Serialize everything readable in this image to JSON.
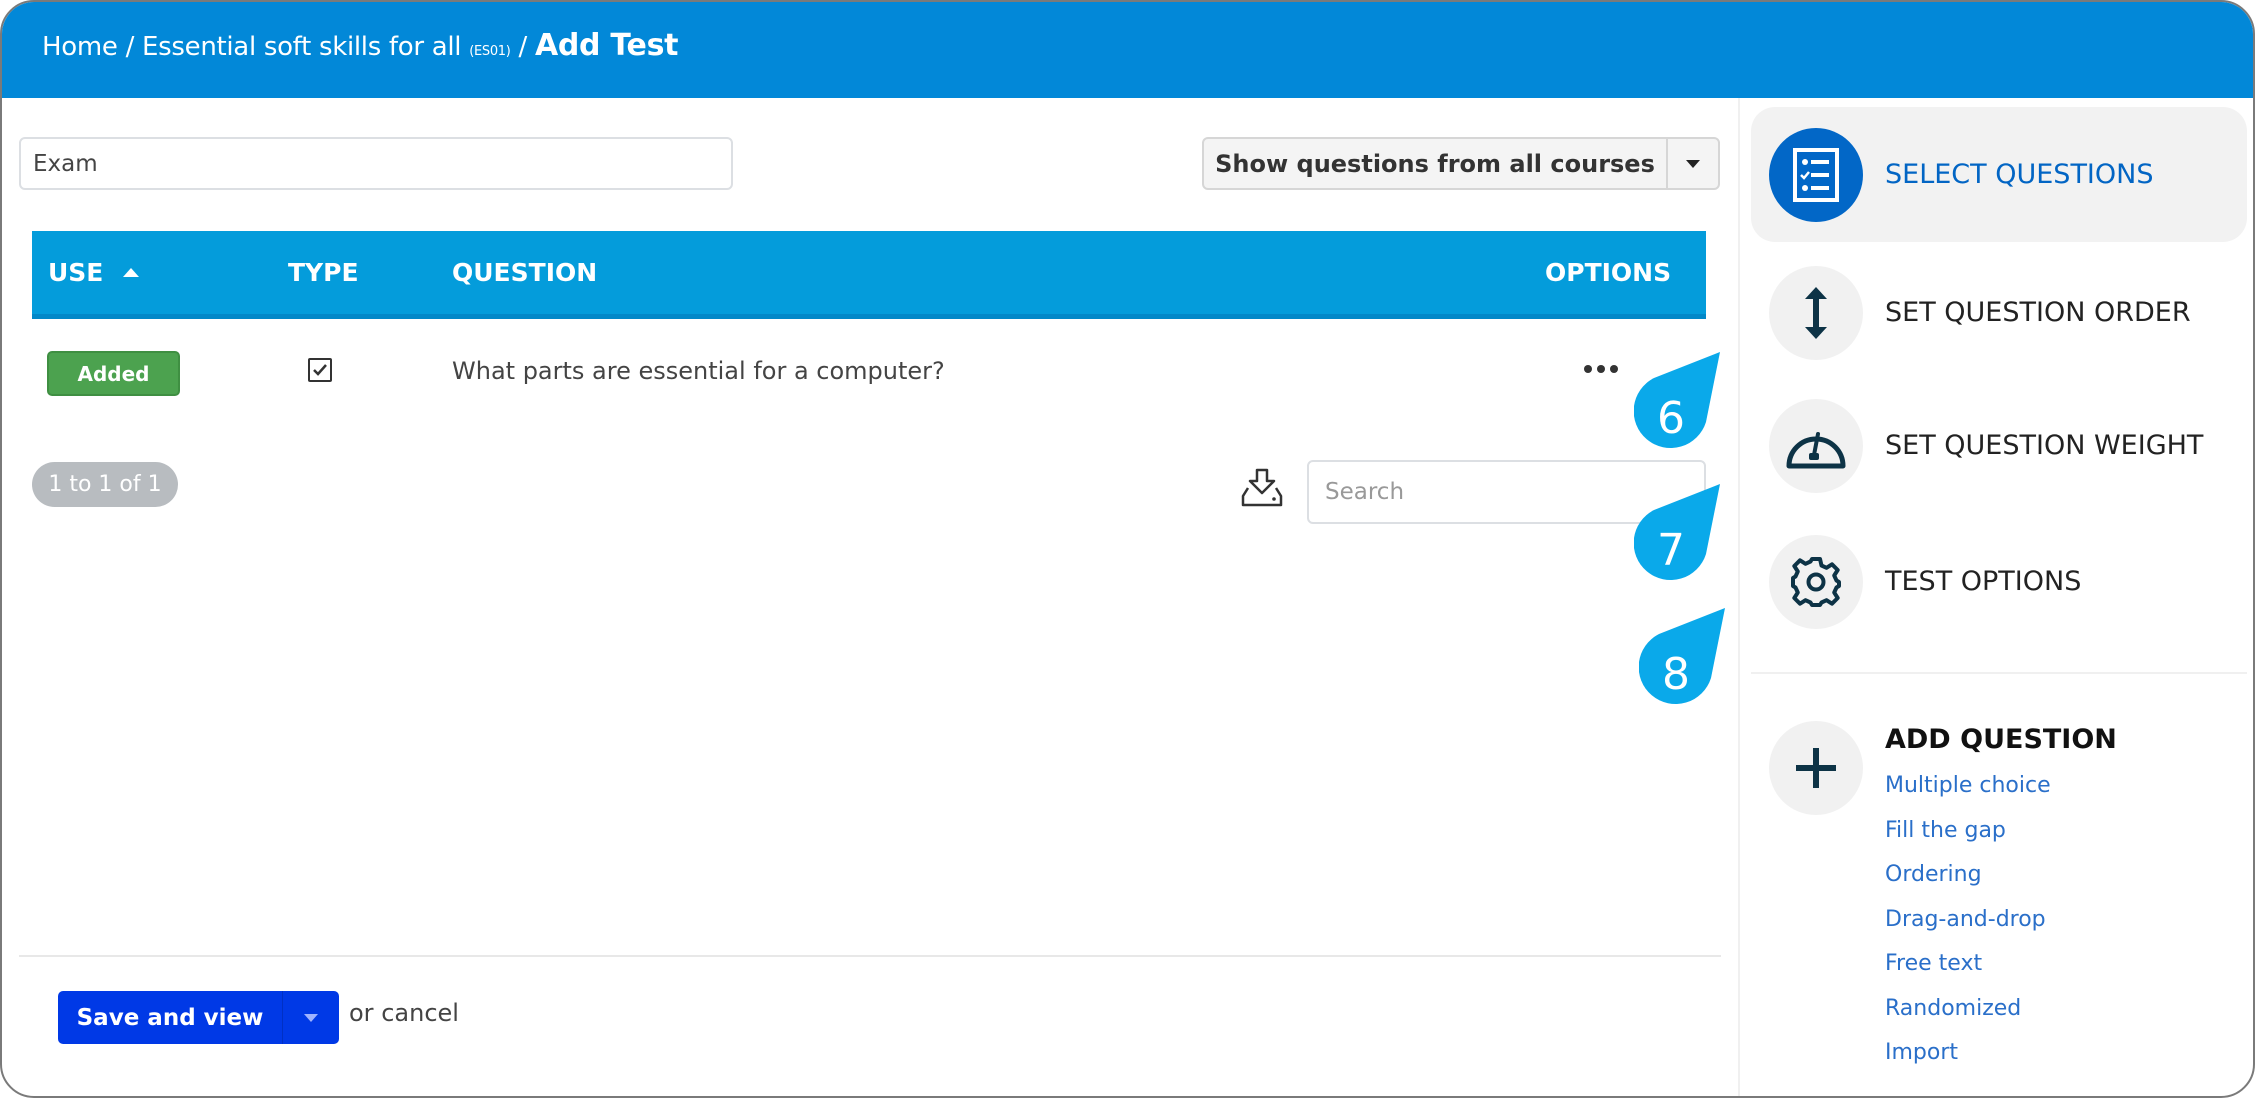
{
  "header": {
    "breadcrumb": [
      {
        "label": "Home"
      },
      {
        "label": "Essential soft skills for all",
        "code": "(ES01)"
      }
    ],
    "separator": "/",
    "current": "Add Test"
  },
  "test_name_input": {
    "value": "Exam"
  },
  "filter_button": {
    "label": "Show questions from all courses"
  },
  "table": {
    "columns": [
      "USE",
      "TYPE",
      "QUESTION",
      "OPTIONS"
    ],
    "sort": {
      "column": "USE",
      "direction": "ascending"
    },
    "rows": [
      {
        "use": "Added",
        "type": "checkbox",
        "question": "What parts are essential for a computer?"
      }
    ],
    "pagination": "1 to 1 of 1",
    "search_placeholder": "Search"
  },
  "footer": {
    "save_label": "Save and view",
    "or_label": "or",
    "cancel_label": "cancel"
  },
  "sidebar": {
    "steps": [
      {
        "label": "SELECT QUESTIONS",
        "icon": "checklist-icon",
        "active": true
      },
      {
        "label": "SET QUESTION ORDER",
        "icon": "vertical-arrows-icon",
        "active": false
      },
      {
        "label": "SET QUESTION WEIGHT",
        "icon": "gauge-icon",
        "active": false
      },
      {
        "label": "TEST OPTIONS",
        "icon": "gear-icon",
        "active": false
      }
    ],
    "add_question": {
      "title": "ADD QUESTION",
      "types": [
        "Multiple choice",
        "Fill the gap",
        "Ordering",
        "Drag-and-drop",
        "Free text",
        "Randomized",
        "Import"
      ]
    }
  },
  "callouts": [
    "6",
    "7",
    "8"
  ],
  "colors": {
    "header": "#0288d8",
    "table_header": "#049cdb",
    "added_badge": "#4ca24f",
    "active_step": "#0267c7",
    "save_button": "#0039e6",
    "link": "#2a6fc9",
    "callout": "#0aa9ea"
  }
}
